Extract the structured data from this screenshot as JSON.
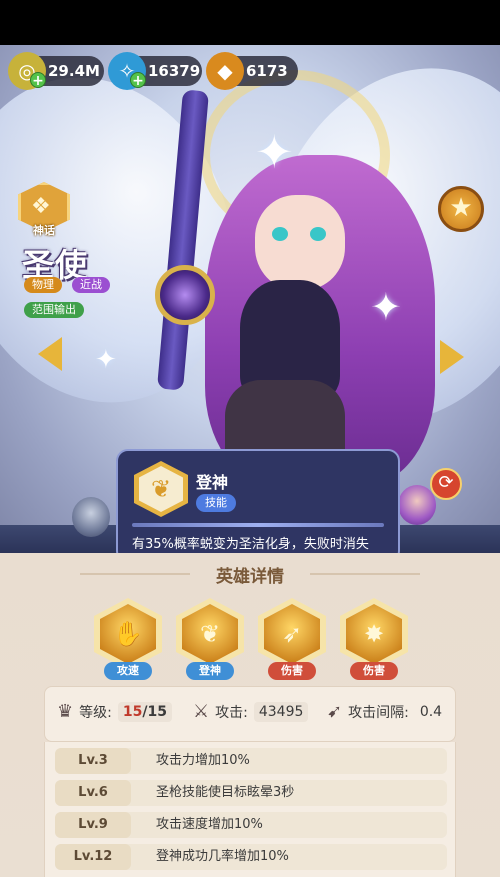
{
  "currency": {
    "gold": "29.4M",
    "gem": "16379",
    "crystal": "6173"
  },
  "hero": {
    "badge_label": "神话",
    "name": "圣使",
    "tags": [
      "物理",
      "近战",
      "范围输出"
    ]
  },
  "tooltip": {
    "title": "登神",
    "tag": "技能",
    "description": "有35%概率蜕变为圣洁化身，失败时消失"
  },
  "details": {
    "title": "英雄详情",
    "skills": [
      {
        "label": "攻速",
        "color": "#3f8fd6",
        "icon": "hands-icon"
      },
      {
        "label": "登神",
        "color": "#3f8fd6",
        "icon": "wings-icon"
      },
      {
        "label": "伤害",
        "color": "#d04e3a",
        "icon": "spear-icon"
      },
      {
        "label": "伤害",
        "color": "#d04e3a",
        "icon": "burst-icon"
      }
    ],
    "stats": {
      "level_label": "等级:",
      "level_current": "15",
      "level_max": "/15",
      "attack_label": "攻击:",
      "attack_value": "43495",
      "interval_label": "攻击间隔:",
      "interval_value": "0.4"
    },
    "upgrades": [
      {
        "level": "Lv.3",
        "text": "攻击力增加10%"
      },
      {
        "level": "Lv.6",
        "text": "圣枪技能使目标眩晕3秒"
      },
      {
        "level": "Lv.9",
        "text": "攻击速度增加10%"
      },
      {
        "level": "Lv.12",
        "text": "登神成功几率增加10%"
      }
    ]
  },
  "colors": {
    "accent_gold": "#e7b53a",
    "tooltip_bg": "#2f3563",
    "panel_bg": "#e9ddd0"
  }
}
